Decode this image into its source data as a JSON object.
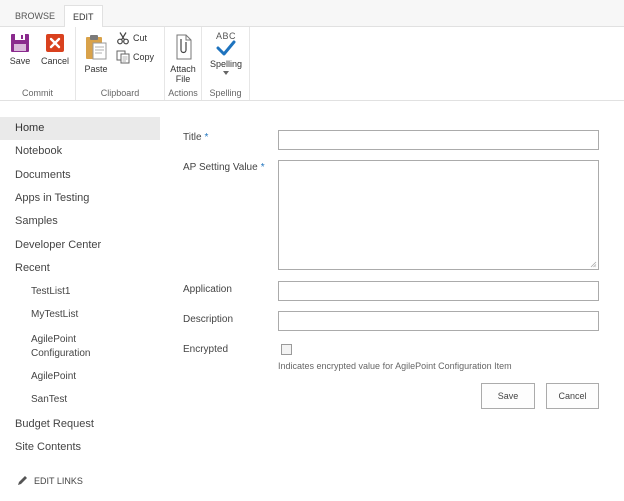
{
  "ribbon": {
    "tabs": [
      {
        "label": "BROWSE"
      },
      {
        "label": "EDIT"
      }
    ],
    "groups": {
      "commit": {
        "label": "Commit",
        "save": "Save",
        "cancel": "Cancel"
      },
      "clipboard": {
        "label": "Clipboard",
        "paste": "Paste",
        "cut": "Cut",
        "copy": "Copy"
      },
      "actions": {
        "label": "Actions",
        "attach_line1": "Attach",
        "attach_line2": "File"
      },
      "spelling": {
        "label": "Spelling",
        "spelling": "Spelling",
        "abc": "ABC"
      }
    },
    "colors": {
      "save": "#8a2a8d",
      "cancel": "#d9411e",
      "check": "#1e73be"
    }
  },
  "nav": {
    "items": [
      {
        "label": "Home"
      },
      {
        "label": "Notebook"
      },
      {
        "label": "Documents"
      },
      {
        "label": "Apps in Testing"
      },
      {
        "label": "Samples"
      },
      {
        "label": "Developer Center"
      },
      {
        "label": "Recent"
      }
    ],
    "recent": [
      {
        "label": "TestList1"
      },
      {
        "label": "MyTestList"
      },
      {
        "label": "AgilePoint"
      },
      {
        "label": "Configuration"
      },
      {
        "label": "AgilePoint"
      },
      {
        "label": "SanTest"
      }
    ],
    "after": [
      {
        "label": "Budget Request"
      },
      {
        "label": "Site Contents"
      }
    ],
    "edit_links": "EDIT LINKS"
  },
  "form": {
    "title_label": "Title",
    "ap_value_label": "AP Setting Value",
    "required_mark": "*",
    "application_label": "Application",
    "description_label": "Description",
    "encrypted_label": "Encrypted",
    "encrypted_hint": "Indicates encrypted value for AgilePoint Configuration Item",
    "title_value": "",
    "ap_value": "",
    "application_value": "",
    "description_value": "",
    "encrypted_checked": false,
    "save_label": "Save",
    "cancel_label": "Cancel"
  }
}
